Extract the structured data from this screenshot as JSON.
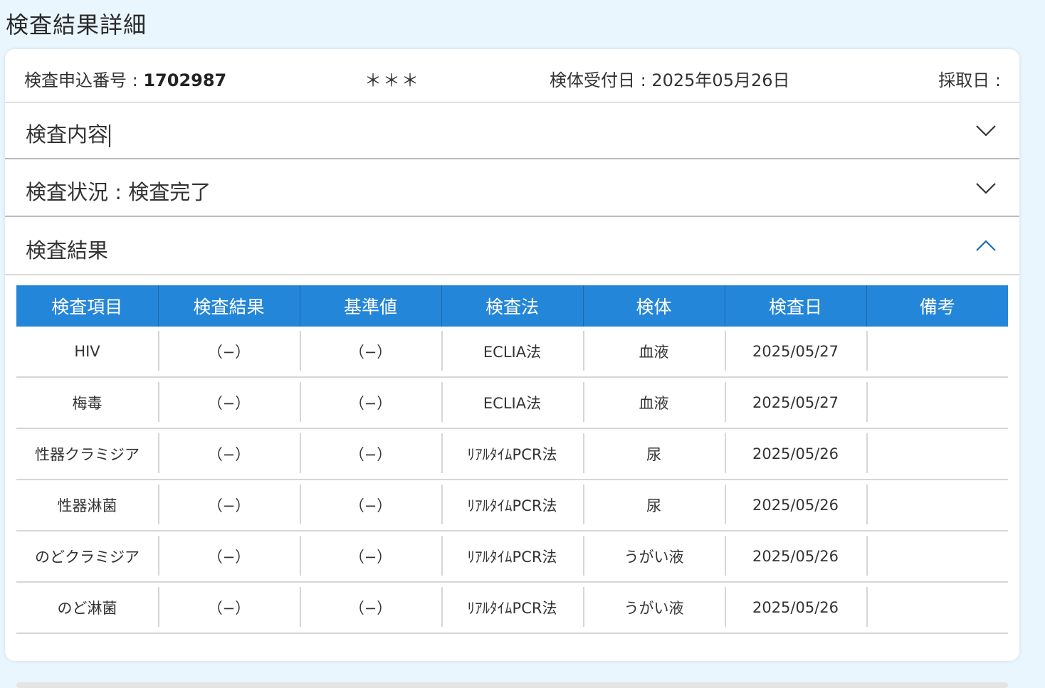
{
  "page_title": "検査結果詳細",
  "info": {
    "application_label": "検査申込番号 : ",
    "application_number": "1702987",
    "masked_name": "＊＊＊",
    "received_text": "検体受付日 : 2025年05月26日",
    "collected_text": "採取日 :"
  },
  "accordion": {
    "content_label": "検査内容",
    "status_label": "検査状況 : 検査完了",
    "results_label": "検査結果"
  },
  "icons": {
    "collapsed": "chevron-down-icon",
    "expanded": "chevron-up-icon"
  },
  "colors": {
    "header_bg": "#2486d8",
    "page_bg": "#eaf6fe"
  },
  "table": {
    "headers": [
      "検査項目",
      "検査結果",
      "基準値",
      "検査法",
      "検体",
      "検査日",
      "備考"
    ],
    "rows": [
      [
        "HIV",
        "（−）",
        "（−）",
        "ECLIA法",
        "血液",
        "2025/05/27",
        ""
      ],
      [
        "梅毒",
        "（−）",
        "（−）",
        "ECLIA法",
        "血液",
        "2025/05/27",
        ""
      ],
      [
        "性器クラミジア",
        "（−）",
        "（−）",
        "ﾘｱﾙﾀｲﾑPCR法",
        "尿",
        "2025/05/26",
        ""
      ],
      [
        "性器淋菌",
        "（−）",
        "（−）",
        "ﾘｱﾙﾀｲﾑPCR法",
        "尿",
        "2025/05/26",
        ""
      ],
      [
        "のどクラミジア",
        "（−）",
        "（−）",
        "ﾘｱﾙﾀｲﾑPCR法",
        "うがい液",
        "2025/05/26",
        ""
      ],
      [
        "のど淋菌",
        "（−）",
        "（−）",
        "ﾘｱﾙﾀｲﾑPCR法",
        "うがい液",
        "2025/05/26",
        ""
      ]
    ]
  }
}
